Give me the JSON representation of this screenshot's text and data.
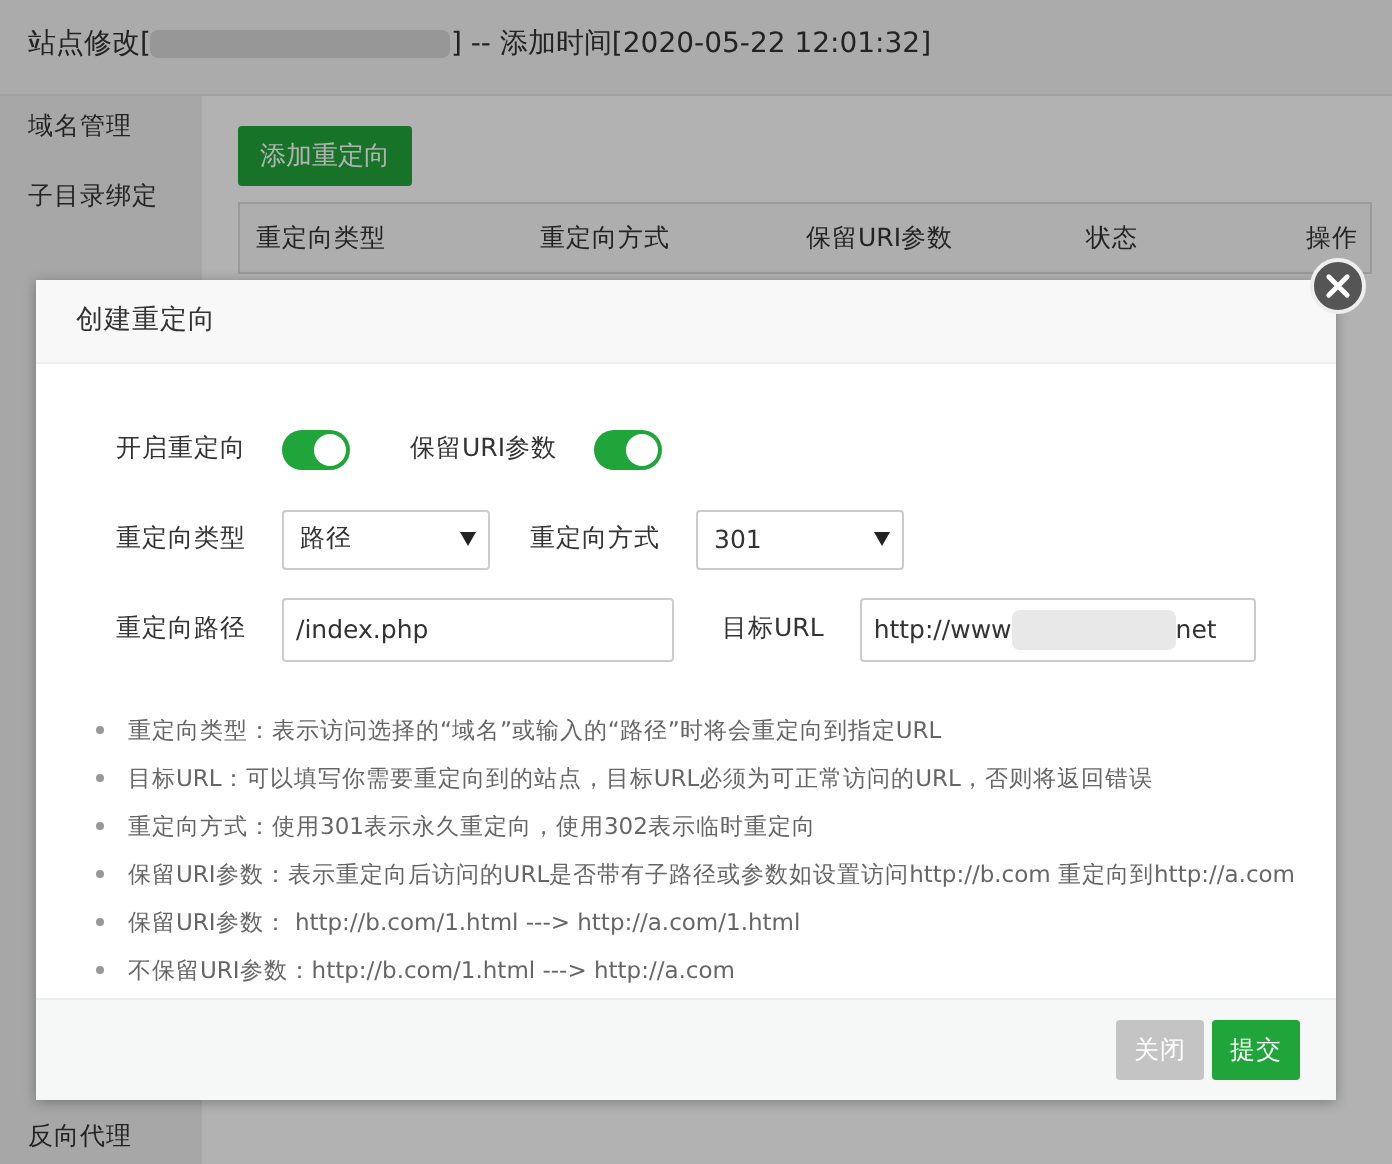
{
  "window": {
    "title_parts": [
      "站点修改[",
      "] -- 添加时间[2020-05-22 12:01:32]"
    ],
    "title_redacted": true
  },
  "sidebar": {
    "items": [
      {
        "label": "域名管理"
      },
      {
        "label": "子目录绑定"
      },
      {
        "label": "反向代理"
      }
    ]
  },
  "add_button": "添加重定向",
  "table": {
    "columns": [
      "重定向类型",
      "重定向方式",
      "保留URI参数",
      "状态",
      "操作"
    ]
  },
  "dialog": {
    "title": "创建重定向",
    "switches": [
      {
        "label": "开启重定向",
        "on": true
      },
      {
        "label": "保留URI参数",
        "on": true
      }
    ],
    "selects": [
      {
        "label": "重定向类型",
        "value": "路径"
      },
      {
        "label": "重定向方式",
        "value": "301"
      }
    ],
    "fields": [
      {
        "label": "重定向路径",
        "value_parts": [
          "/index.php"
        ]
      },
      {
        "label": "目标URL",
        "value_parts": [
          "http://www",
          "net"
        ],
        "redacted": true
      }
    ],
    "notes": [
      "重定向类型：表示访问选择的“域名”或输入的“路径”时将会重定向到指定URL",
      "目标URL：可以填写你需要重定向到的站点，目标URL必须为可正常访问的URL，否则将返回错误",
      "重定向方式：使用301表示永久重定向，使用302表示临时重定向",
      "保留URI参数：表示重定向后访问的URL是否带有子路径或参数如设置访问http://b.com 重定向到http://a.com",
      "保留URI参数： http://b.com/1.html ---> http://a.com/1.html",
      "不保留URI参数：http://b.com/1.html ---> http://a.com"
    ],
    "buttons": [
      {
        "label": "关闭",
        "kind": "secondary"
      },
      {
        "label": "提交",
        "kind": "primary"
      }
    ]
  }
}
